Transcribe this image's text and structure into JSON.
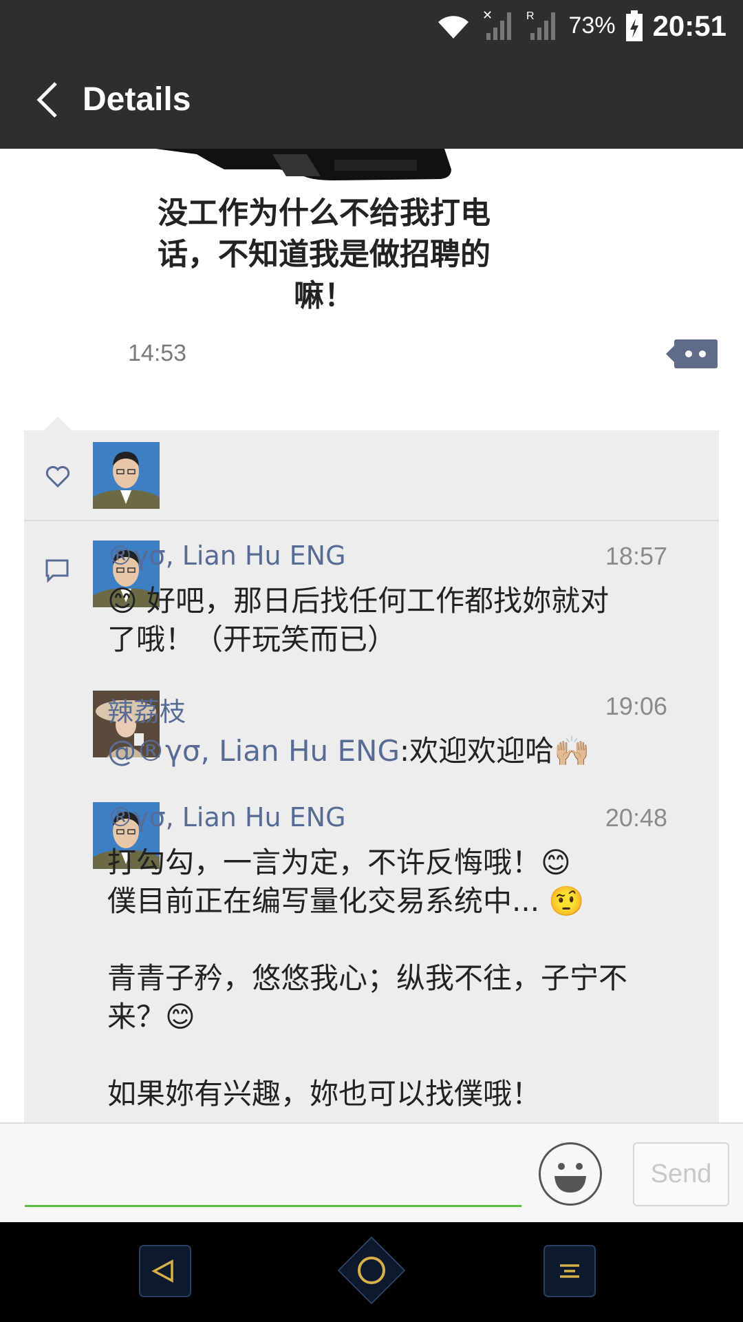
{
  "status_bar": {
    "battery_percent": "73%",
    "time": "20:51",
    "icons": [
      "wifi-icon",
      "signal-x-icon",
      "signal-roaming-icon",
      "battery-charging-icon"
    ]
  },
  "header": {
    "title": "Details"
  },
  "post": {
    "image_caption": "没工作为什么不给我打电话，不知道我是做招聘的嘛！",
    "time": "14:53"
  },
  "comments": [
    {
      "name": "®γσ, Lian Hu ENG",
      "time": "18:57",
      "text": "😊 好吧，那日后找任何工作都找妳就对了哦！（开玩笑而已）"
    },
    {
      "name": "辣荔枝",
      "time": "19:06",
      "mention": "@®γσ, Lian Hu ENG",
      "text": ":欢迎欢迎哈🙌🏼"
    },
    {
      "name": "®γσ, Lian Hu ENG",
      "time": "20:48",
      "text": "打勾勾，一言为定，不许反悔哦！😊\n僕目前正在编写量化交易系统中... 🤨\n\n青青子矜，悠悠我心；纵我不往，子宁不来？😊\n\n如果妳有兴趣，妳也可以找僕哦！"
    }
  ],
  "input": {
    "placeholder": "",
    "send_label": "Send"
  },
  "colors": {
    "bar": "#2e2e2e",
    "link": "#576b95",
    "input_line": "#5fbf3a"
  }
}
